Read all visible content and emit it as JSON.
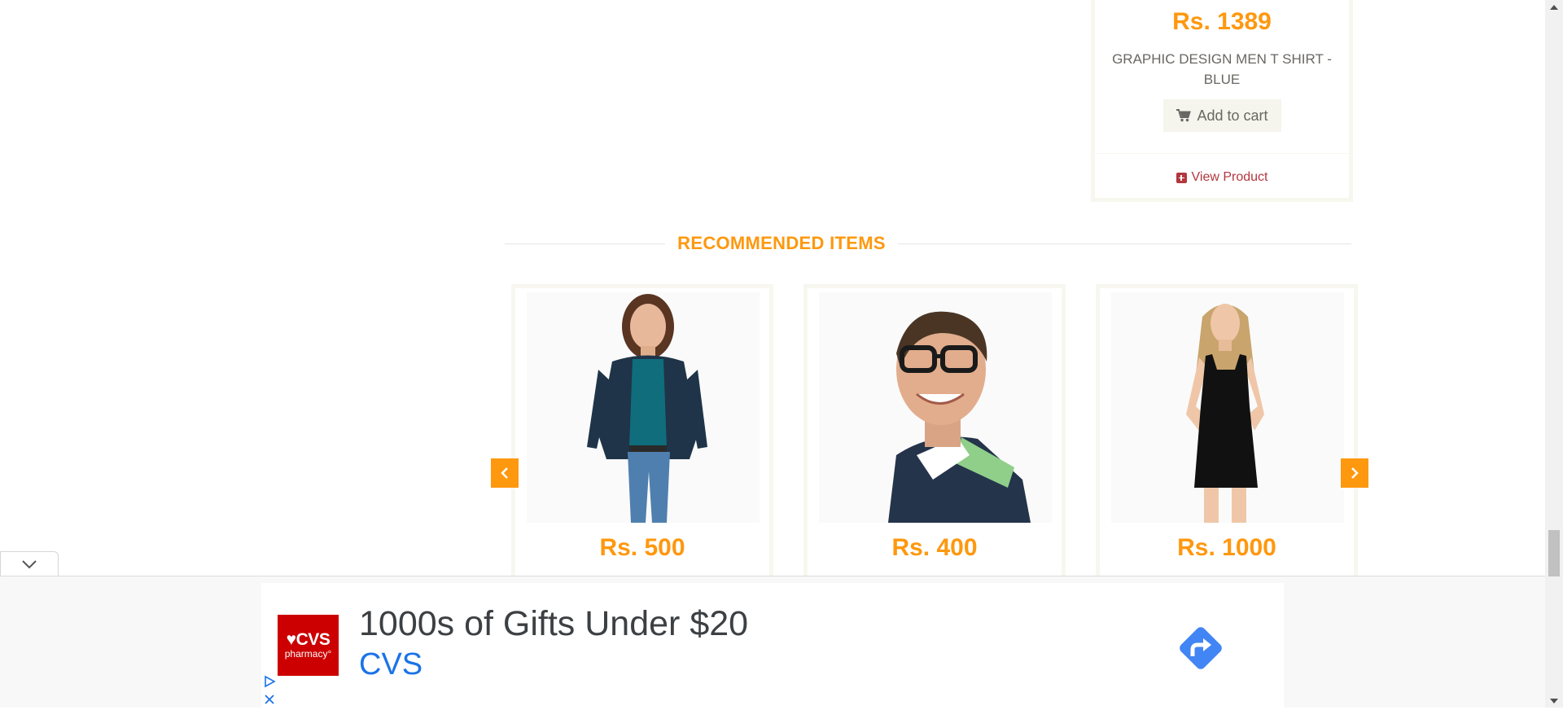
{
  "top_product": {
    "price": "Rs. 1389",
    "name": "GRAPHIC DESIGN MEN T SHIRT - BLUE",
    "add_to_cart": "Add to cart",
    "view_product": "View Product"
  },
  "recommended": {
    "title": "RECOMMENDED ITEMS",
    "items": [
      {
        "price": "Rs. 500",
        "image": "woman-denim-jacket"
      },
      {
        "price": "Rs. 400",
        "image": "man-glasses-polo"
      },
      {
        "price": "Rs. 1000",
        "image": "woman-black-dress"
      }
    ],
    "prev_icon": "chevron-left-icon",
    "next_icon": "chevron-right-icon"
  },
  "ad": {
    "logo_line1": "♥CVS",
    "logo_line2": "pharmacy°",
    "headline": "1000s of Gifts Under $20",
    "brand": "CVS"
  },
  "colors": {
    "accent": "#FE980F",
    "link": "#B3373F",
    "ad_brand": "#1a73e8",
    "cvs_red": "#CC0000"
  }
}
